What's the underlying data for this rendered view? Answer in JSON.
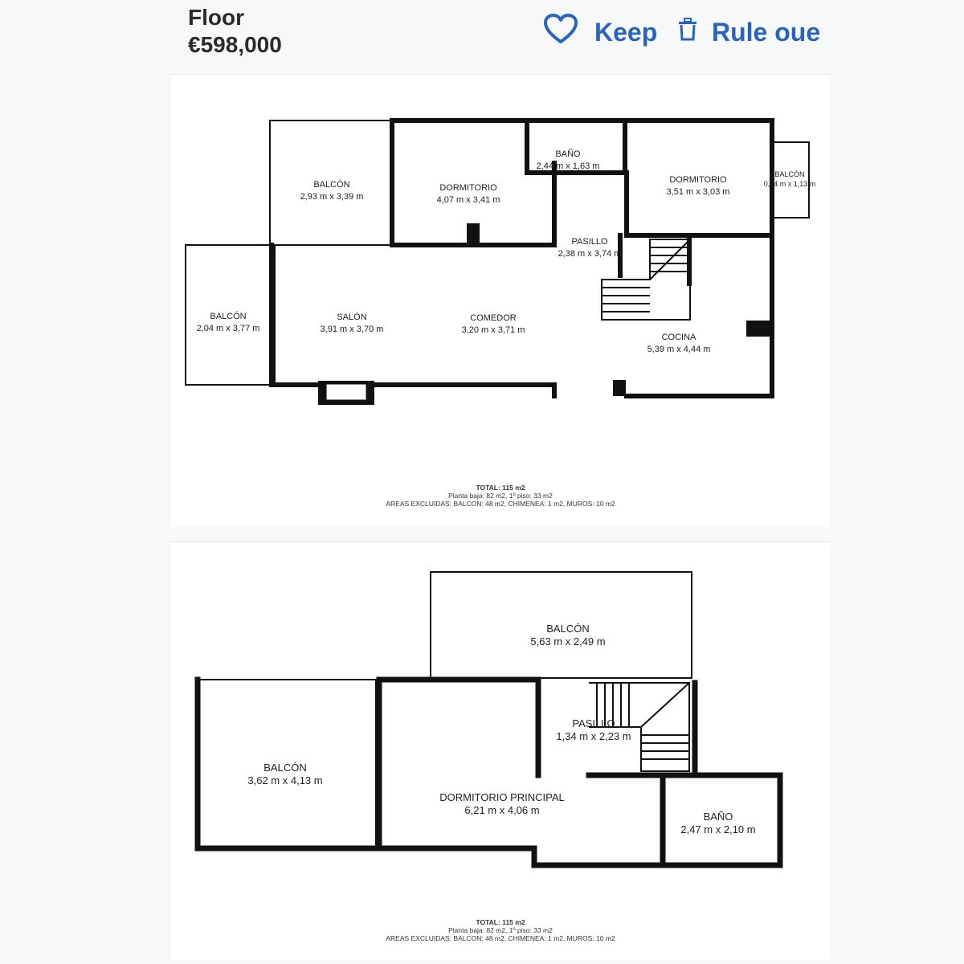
{
  "header": {
    "title": "Floor",
    "price": "€598,000"
  },
  "actions": {
    "keep": {
      "label": "Keep",
      "icon": "heart-icon"
    },
    "rule": {
      "label": "Rule oue",
      "icon": "trash-icon"
    }
  },
  "colors": {
    "accent": "#2a63b8",
    "wall": "#111111"
  },
  "floor1": {
    "rooms": [
      {
        "name": "BALCÓN",
        "dims": "2,93 m x 3,39 m"
      },
      {
        "name": "DORMITORIO",
        "dims": "4,07 m x 3,41 m"
      },
      {
        "name": "BAÑO",
        "dims": "2,44 m x 1,63 m"
      },
      {
        "name": "DORMITORIO",
        "dims": "3,51 m x 3,03 m"
      },
      {
        "name": "BALCÓN",
        "dims": "0,74 m x 1,13 m"
      },
      {
        "name": "PASILLO",
        "dims": "2,38 m x 3,74 m"
      },
      {
        "name": "BALCÓN",
        "dims": "2,04 m x 3,77 m"
      },
      {
        "name": "SALÓN",
        "dims": "3,91 m x 3,70 m"
      },
      {
        "name": "COMEDOR",
        "dims": "3,20 m x 3,71 m"
      },
      {
        "name": "COCINA",
        "dims": "5,39 m x 4,44 m"
      }
    ],
    "total": "TOTAL: 115 m2",
    "line2": "Planta baja: 82 m2, 1º piso: 33 m2",
    "line3": "AREAS EXCLUIDAS: BALCON: 48 m2, CHIMENEA: 1 m2, MUROS: 10 m2"
  },
  "floor2": {
    "rooms": [
      {
        "name": "BALCÓN",
        "dims": "5,63 m x 2,49 m"
      },
      {
        "name": "PASILLO",
        "dims": "1,34 m x 2,23 m"
      },
      {
        "name": "BALCÓN",
        "dims": "3,62 m x 4,13 m"
      },
      {
        "name": "DORMITORIO PRINCIPAL",
        "dims": "6,21 m x 4,06 m"
      },
      {
        "name": "BAÑO",
        "dims": "2,47 m x 2,10 m"
      }
    ],
    "total": "TOTAL: 115 m2",
    "line2": "Planta baja: 82 m2, 1º piso: 33 m2",
    "line3": "AREAS EXCLUIDAS: BALCON: 48 m2, CHIMENEA: 1 m2, MUROS: 10 m2"
  }
}
